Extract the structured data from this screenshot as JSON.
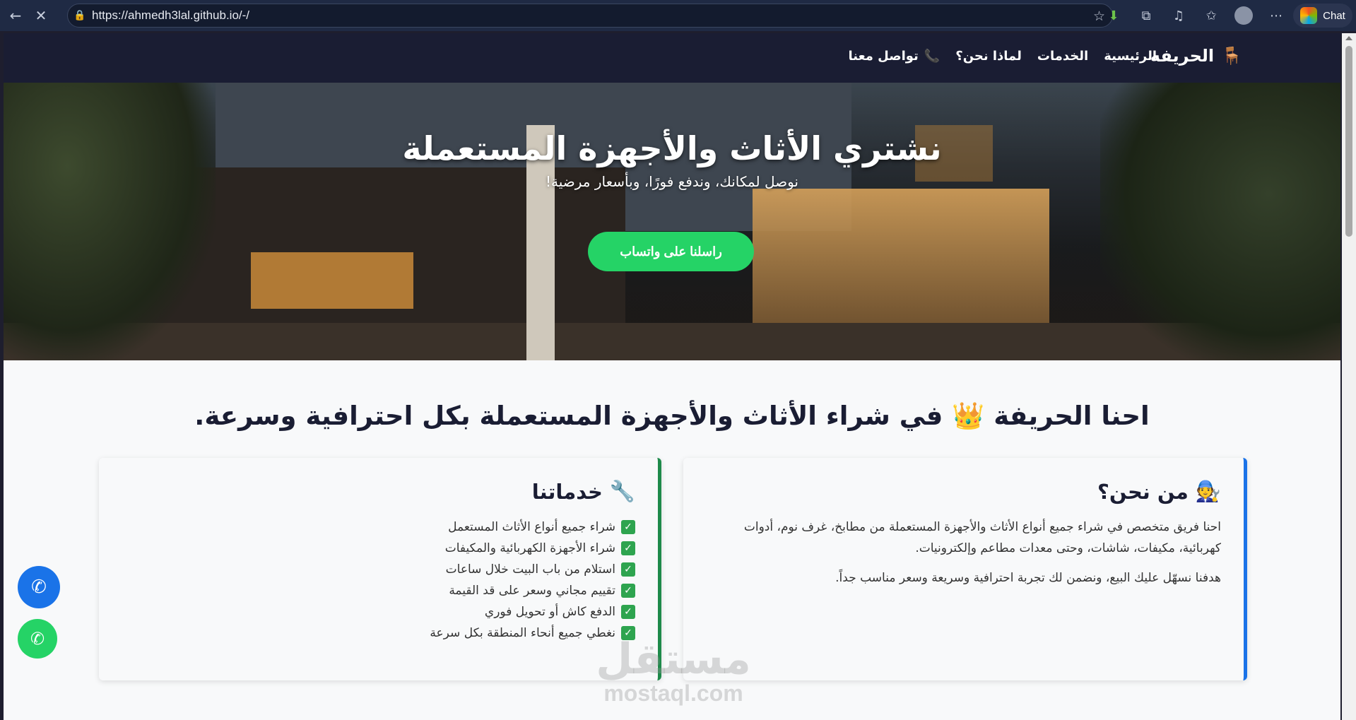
{
  "browser": {
    "url": "https://ahmedh3lal.github.io/-/",
    "chat_label": "Chat",
    "icons": [
      "back-icon",
      "stop-icon",
      "lock-icon",
      "star-icon",
      "download-icon",
      "extensions-icon",
      "media-icon",
      "favorites-icon",
      "profile-icon",
      "more-icon"
    ]
  },
  "navbar": {
    "brand": "الحريفه",
    "brand_icon": "🪑",
    "links": [
      "الرئيسية",
      "الخدمات",
      "لماذا نحن؟",
      "تواصل معنا"
    ],
    "contact_icon": "📞"
  },
  "hero": {
    "title": "نشتري الأثاث والأجهزة المستعملة",
    "subtitle": "نوصل لمكانك، وندفع فورًا، وبأسعار مرضية!",
    "cta": "راسلنا على واتساب"
  },
  "intro": {
    "headline": "احنا الحريفة 👑 في شراء الأثاث والأجهزة المستعملة بكل احترافية وسرعة."
  },
  "about": {
    "icon": "🧑‍🔧",
    "title": "من نحن؟",
    "p1": "احنا فريق متخصص في شراء جميع أنواع الأثاث والأجهزة المستعملة من مطابخ، غرف نوم، أدوات كهربائية، مكيفات، شاشات، وحتى معدات مطاعم وإلكترونيات.",
    "p2": "هدفنا نسهّل عليك البيع، ونضمن لك تجربة احترافية وسريعة وسعر مناسب جداً."
  },
  "services": {
    "icon": "🔧",
    "title": "خدماتنا",
    "items": [
      "شراء جميع أنواع الأثاث المستعمل",
      "شراء الأجهزة الكهربائية والمكيفات",
      "استلام من باب البيت خلال ساعات",
      "تقييم مجاني وسعر على قد القيمة",
      "الدفع كاش أو تحويل فوري",
      "نغطي جميع أنحاء المنطقة بكل سرعة"
    ]
  },
  "watermark": {
    "ar": "مستقل",
    "en": "mostaql.com"
  },
  "colors": {
    "navbar": "#1a1d33",
    "cta": "#25d366",
    "about_border": "#1a73e8",
    "services_border": "#1e8a4a"
  }
}
